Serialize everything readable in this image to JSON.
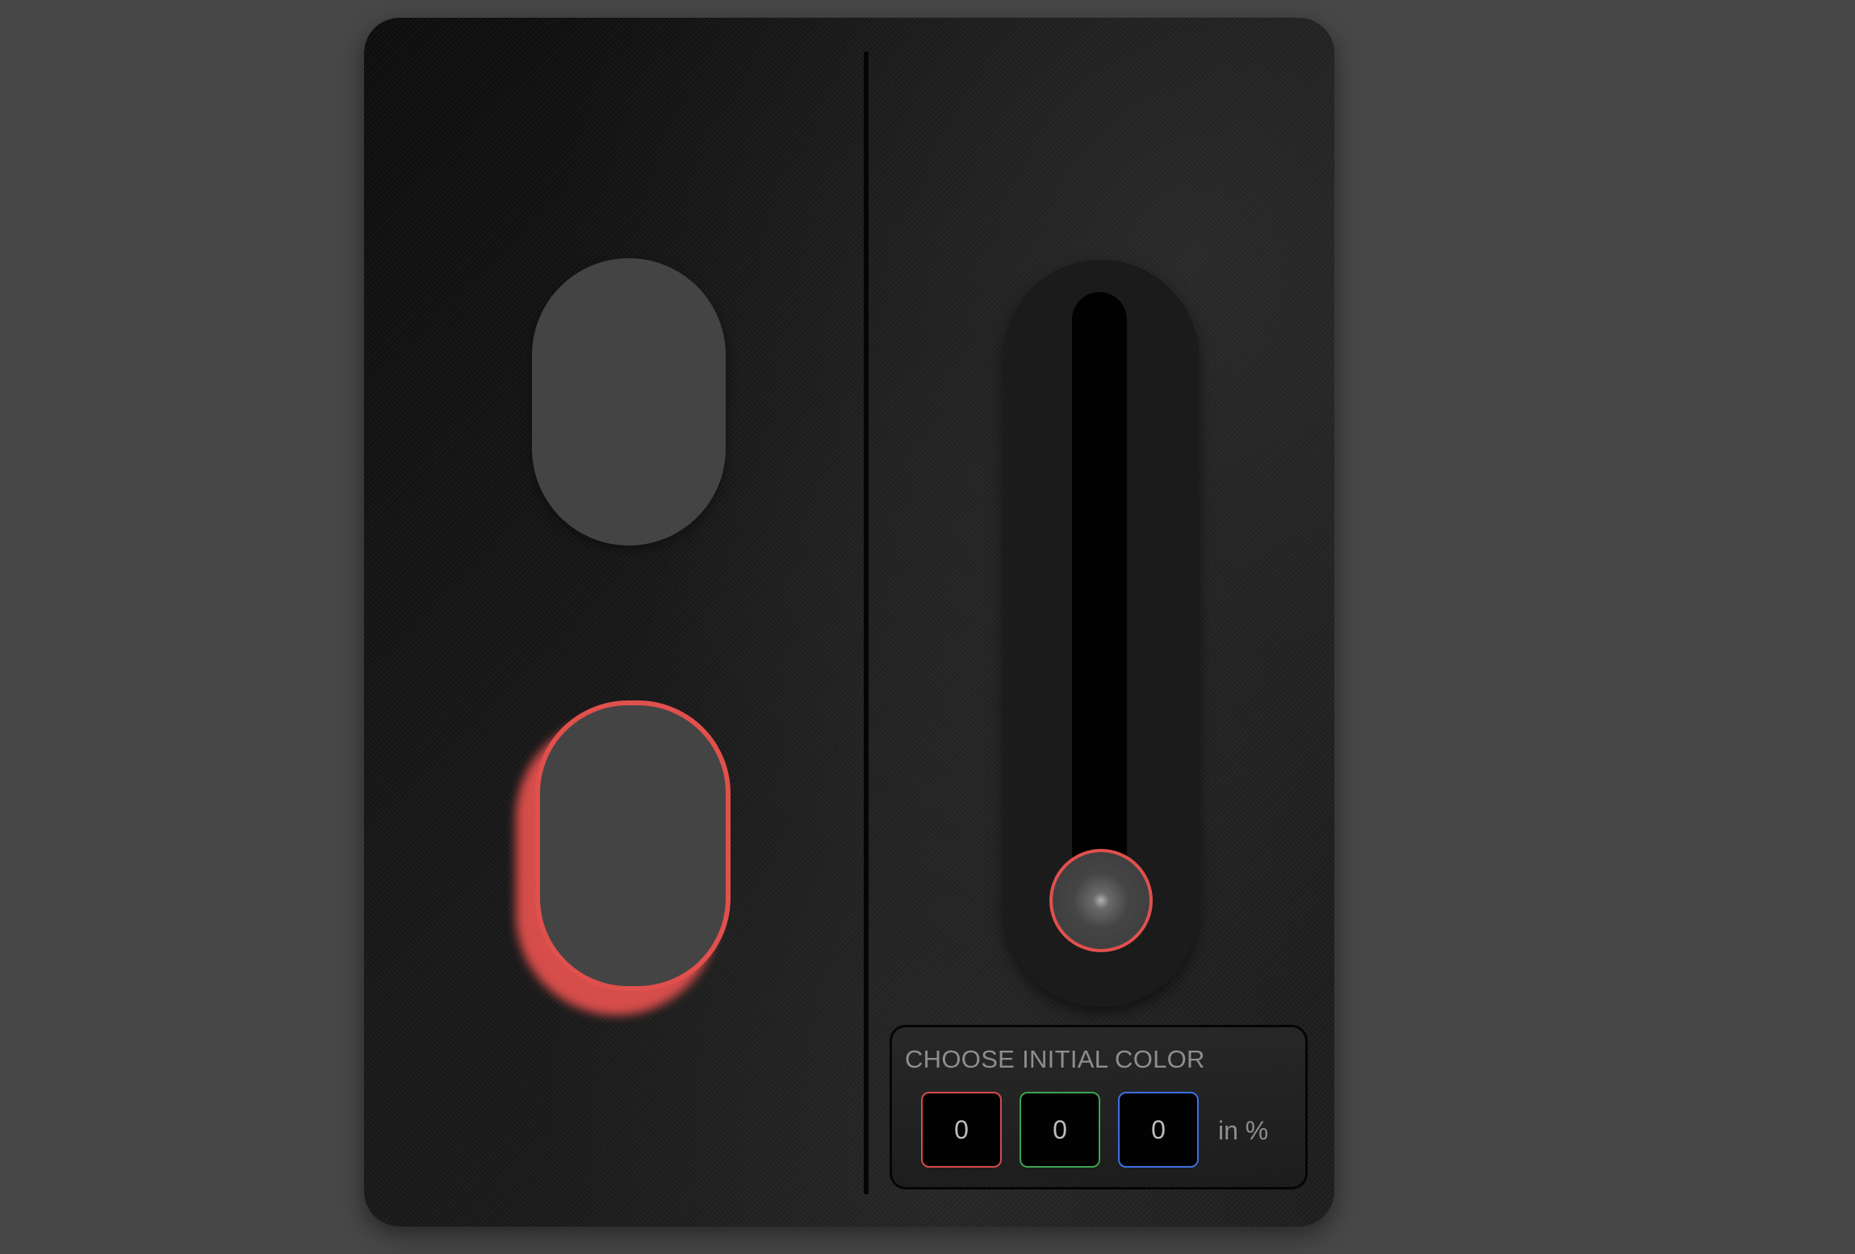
{
  "colors": {
    "page_background": "#474747",
    "panel_dark": "#111111",
    "switch_fill": "#444444",
    "accent_red": "#e0504d",
    "input_green": "#3aa34e",
    "input_blue": "#3e6fe0",
    "label_gray": "#8e8e8e"
  },
  "left_panel": {
    "top_switch": {
      "state": "off"
    },
    "bottom_switch": {
      "state": "on",
      "highlight": "red"
    }
  },
  "slider": {
    "value_fraction": 0.0,
    "thumb_icon": "radial-knob-icon"
  },
  "color_picker": {
    "title": "CHOOSE INITIAL COLOR",
    "inputs": [
      {
        "channel": "red",
        "value": "0"
      },
      {
        "channel": "green",
        "value": "0"
      },
      {
        "channel": "blue",
        "value": "0"
      }
    ],
    "unit_label": "in %"
  }
}
